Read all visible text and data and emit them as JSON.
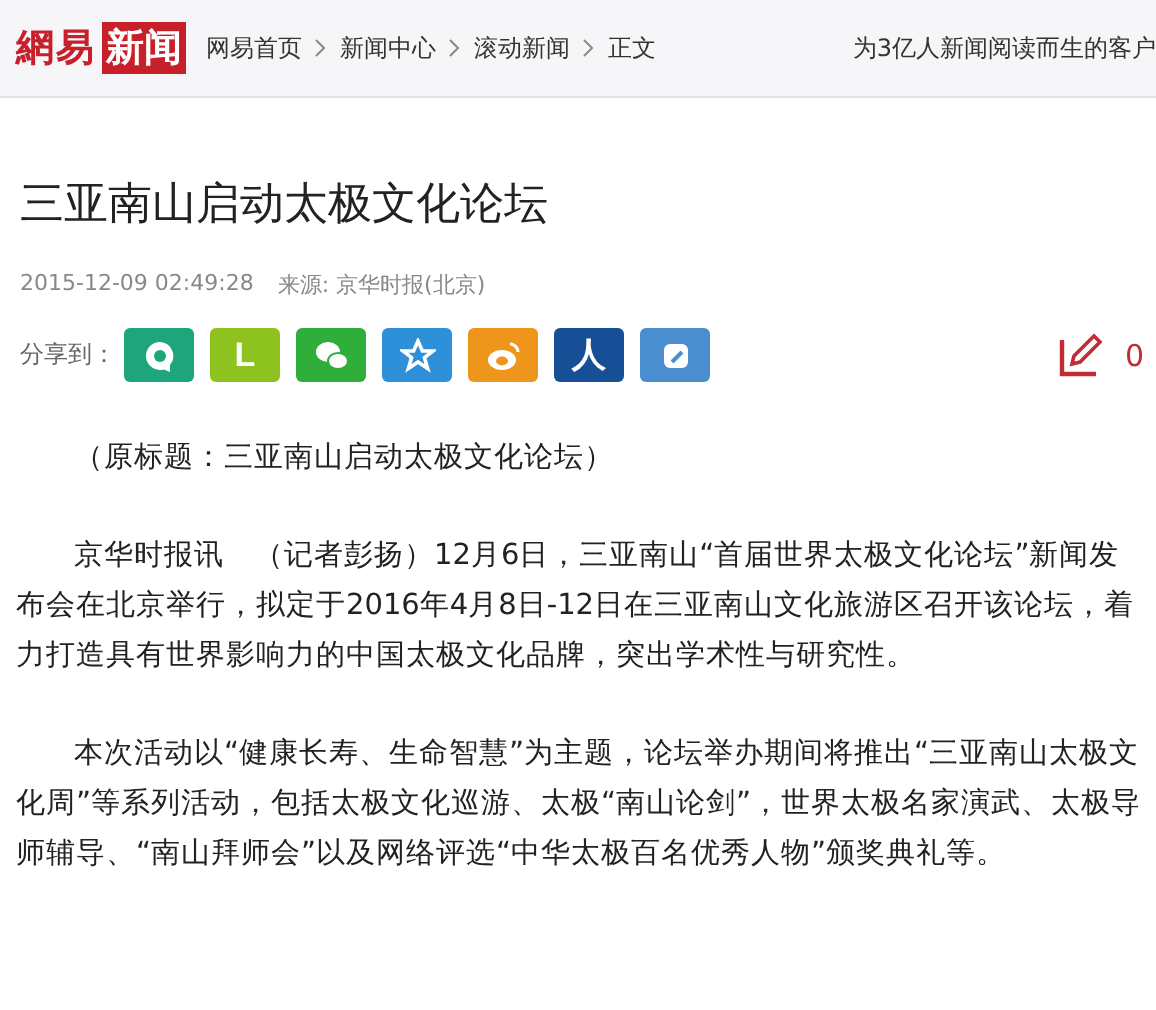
{
  "header": {
    "logo": {
      "plain": "網易",
      "boxed": "新闻"
    },
    "breadcrumbs": [
      "网易首页",
      "新闻中心",
      "滚动新闻",
      "正文"
    ],
    "slogan": "为3亿人新闻阅读而生的客户"
  },
  "article": {
    "title": "三亚南山启动太极文化论坛",
    "date": "2015-12-09 02:49:28",
    "source": "来源: 京华时报(北京)"
  },
  "share": {
    "label": "分享到：",
    "buttons": [
      {
        "kind": "bubble",
        "color": "#1ea57c"
      },
      {
        "kind": "glyph",
        "glyph": "L",
        "color": "#8dc21f"
      },
      {
        "kind": "chat",
        "color": "#2fae3c"
      },
      {
        "kind": "star",
        "color": "#2e90d8"
      },
      {
        "kind": "eye",
        "color": "#ee951c"
      },
      {
        "kind": "glyph",
        "glyph": "人",
        "color": "#174f96"
      },
      {
        "kind": "note",
        "color": "#4a8ecf"
      }
    ],
    "comment_count": "0"
  },
  "paragraphs": [
    "（原标题：三亚南山启动太极文化论坛）",
    "京华时报讯　（记者彭扬）12月6日，三亚南山“首届世界太极文化论坛”新闻发布会在北京举行，拟定于2016年4月8日-12日在三亚南山文化旅游区召开该论坛，着力打造具有世界影响力的中国太极文化品牌，突出学术性与研究性。",
    "本次活动以“健康长寿、生命智慧”为主题，论坛举办期间将推出“三亚南山太极文化周”等系列活动，包括太极文化巡游、太极“南山论剑”，世界太极名家演武、太极导师辅导、“南山拜师会”以及网络评选“中华太极百名优秀人物”颁奖典礼等。"
  ]
}
